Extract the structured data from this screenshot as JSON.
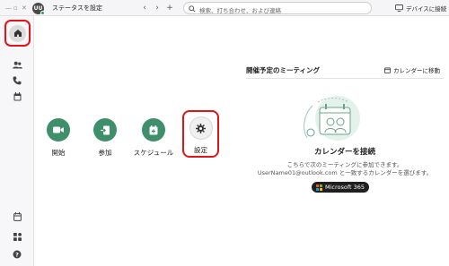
{
  "titlebar": {
    "window_controls": [
      "—",
      "▫",
      "✕"
    ],
    "avatar_initials": "UU",
    "status_label": "ステータスを設定",
    "back_glyph": "‹",
    "forward_glyph": "›",
    "new_glyph": "+",
    "search_placeholder": "検索、打ち合わせ、および連絡",
    "device_connect_label": "デバイスに接続"
  },
  "sidebar": {
    "items": [
      {
        "icon": "home-icon",
        "selected": true
      },
      {
        "icon": "people-icon"
      },
      {
        "icon": "phone-icon"
      },
      {
        "icon": "calendar-icon"
      },
      {
        "icon": "calendar-add-icon"
      },
      {
        "icon": "apps-icon"
      },
      {
        "icon": "help-icon"
      }
    ]
  },
  "main": {
    "actions": [
      {
        "label": "開始",
        "icon": "video-camera-icon"
      },
      {
        "label": "参加",
        "icon": "join-door-icon"
      },
      {
        "label": "スケジュール",
        "icon": "schedule-calendar-icon"
      },
      {
        "label": "設定",
        "icon": "gear-icon"
      }
    ]
  },
  "meetings": {
    "title": "開催予定のミーティング",
    "go_to_calendar_label": "カレンダーに移動",
    "connect_title": "カレンダーを接続",
    "connect_desc_line1": "こちらで次のミーティングに参加できます。",
    "connect_desc_line2": "UserName01@outlook.com と一致するカレンダーを選びます。",
    "provider_button_label": "Microsoft 365"
  },
  "colors": {
    "accent_green": "#3f8f6b",
    "highlight_red": "#e01515",
    "ms_red": "#f25022",
    "ms_green": "#7fba00",
    "ms_blue": "#00a4ef",
    "ms_yellow": "#ffb900"
  }
}
